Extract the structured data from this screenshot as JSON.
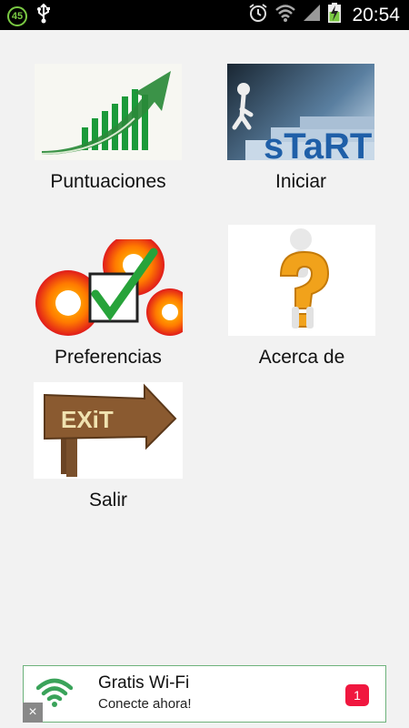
{
  "statusbar": {
    "notification_count": "45",
    "time": "20:54"
  },
  "menu": {
    "items": [
      {
        "label": "Puntuaciones"
      },
      {
        "label": "Iniciar"
      },
      {
        "label": "Preferencias"
      },
      {
        "label": "Acerca de"
      },
      {
        "label": "Salir"
      }
    ],
    "start_image_text": "sTaRT",
    "exit_image_text": "EXiT"
  },
  "ad": {
    "title": "Gratis  Wi-Fi",
    "subtitle": "Conecte ahora!",
    "count": "1",
    "close_symbol": "×"
  },
  "colors": {
    "statusbar_bg": "#000000",
    "background": "#f2f2f2",
    "ad_border": "#6db27b",
    "ad_badge": "#f0173f",
    "wifi_green": "#3aa35a"
  }
}
